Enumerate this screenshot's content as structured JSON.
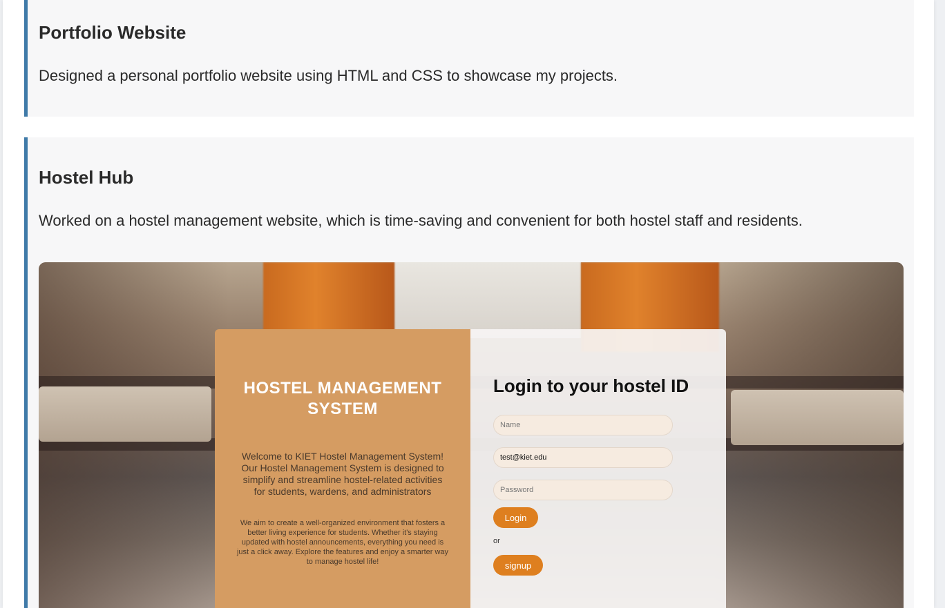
{
  "projects": [
    {
      "title": "Portfolio Website",
      "description": "Designed a personal portfolio website using HTML and CSS to showcase my projects."
    },
    {
      "title": "Hostel Hub",
      "description": "Worked on a hostel management website, which is time-saving and convenient for both hostel staff and residents.",
      "screenshot": {
        "system_title": "HOSTEL MANAGEMENT SYSTEM",
        "welcome_text": "Welcome to KIET Hostel Management System! Our Hostel Management System is designed to simplify and streamline hostel-related activities for students, wardens, and administrators",
        "about_text": "We aim to create a well-organized environment that fosters a better living experience for students. Whether it's staying updated with hostel announcements, everything you need is just a click away. Explore the features and enjoy a smarter way to manage hostel life!",
        "login_heading": "Login to your hostel ID",
        "name_placeholder": "Name",
        "email_value": "test@kiet.edu",
        "password_placeholder": "Password",
        "login_label": "Login",
        "or_label": "or",
        "signup_label": "signup"
      }
    }
  ],
  "colors": {
    "accent_border": "#3f7aa8",
    "card_background": "#f7f7f8",
    "panel_orange": "#d59c62",
    "button_orange": "#de7f1f"
  }
}
